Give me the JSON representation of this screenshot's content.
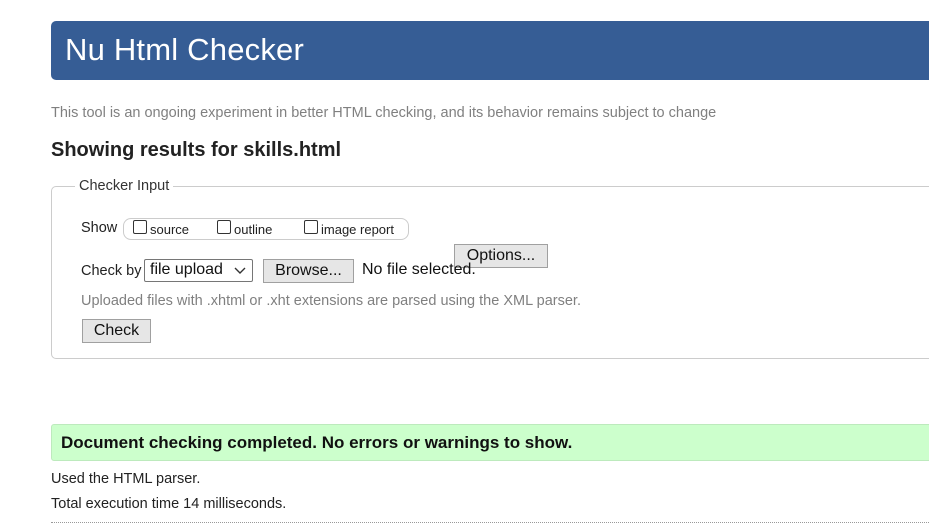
{
  "header": {
    "title": "Nu Html Checker",
    "background_color": "#365d95"
  },
  "intro_text": "This tool is an ongoing experiment in better HTML checking, and its behavior remains subject to change",
  "results_heading": "Showing results for skills.html",
  "checker_input": {
    "legend": "Checker Input",
    "show_label": "Show",
    "show_options": [
      {
        "label": "source",
        "checked": false
      },
      {
        "label": "outline",
        "checked": false
      },
      {
        "label": "image report",
        "checked": false
      }
    ],
    "options_button": "Options...",
    "check_by_label": "Check by",
    "check_by_selected": "file upload",
    "browse_button": "Browse...",
    "file_status": "No file selected.",
    "hint": "Uploaded files with .xhtml or .xht extensions are parsed using the XML parser.",
    "check_button": "Check"
  },
  "result": {
    "success_message": "Document checking completed. No errors or warnings to show.",
    "success_color": "#ccffcc",
    "parser_info": "Used the HTML parser.",
    "execution_time": "Total execution time 14 milliseconds."
  }
}
